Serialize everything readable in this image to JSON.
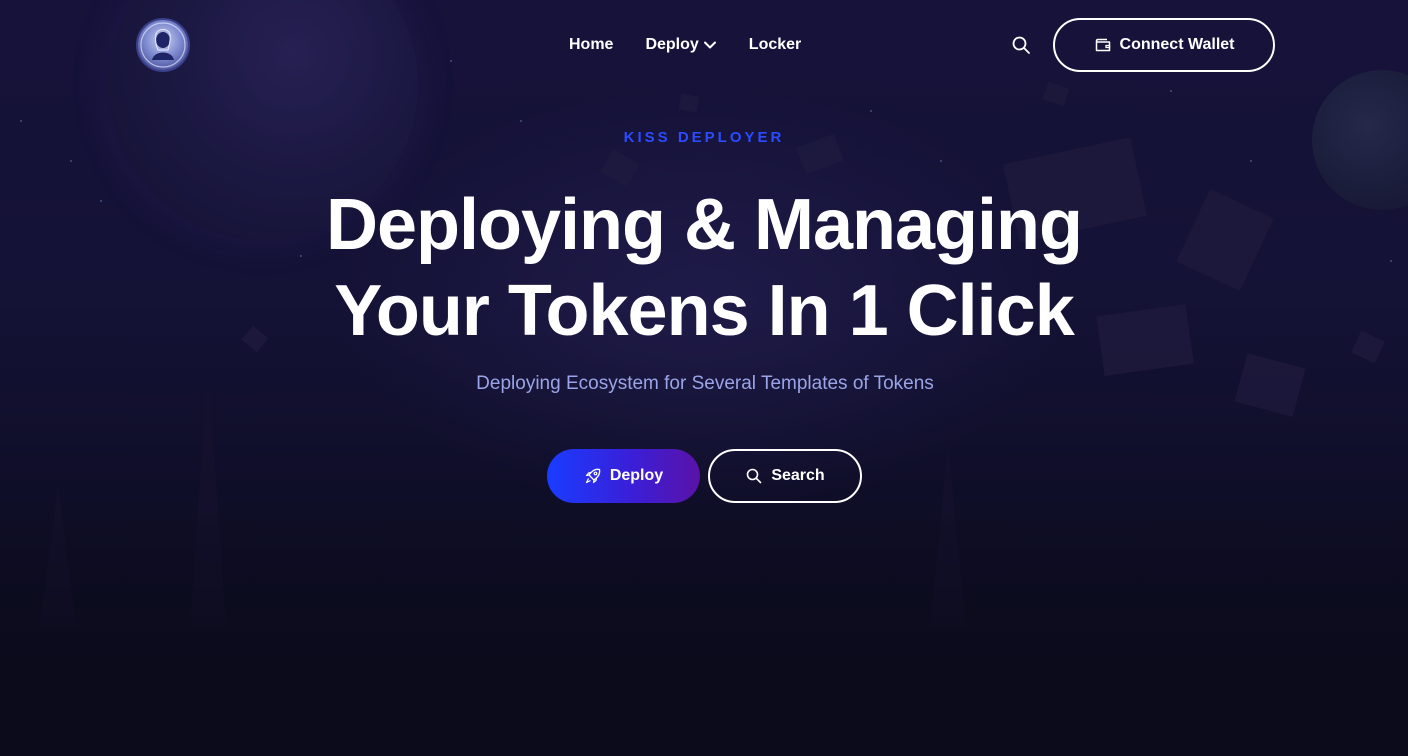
{
  "header": {
    "logo_icon": "kiss-portrait-logo-icon",
    "nav": [
      {
        "label": "Home",
        "has_dropdown": false
      },
      {
        "label": "Deploy",
        "has_dropdown": true
      },
      {
        "label": "Locker",
        "has_dropdown": false
      }
    ],
    "search_icon": "search-icon",
    "connect_wallet": {
      "label": "Connect Wallet",
      "icon": "wallet-icon"
    }
  },
  "hero": {
    "eyebrow": "KISS DEPLOYER",
    "title_line1": "Deploying & Managing",
    "title_line2": "Your Tokens In 1 Click",
    "subtitle": "Deploying Ecosystem for Several Templates of Tokens",
    "buttons": {
      "deploy": {
        "label": "Deploy",
        "icon": "rocket-icon"
      },
      "search": {
        "label": "Search",
        "icon": "search-icon"
      }
    }
  },
  "colors": {
    "background": "#0b0b1c",
    "accent_blue": "#2a4bff",
    "subtitle": "#9aa4e6",
    "deploy_gradient_start": "#1a3cff",
    "deploy_gradient_end": "#5a12a8",
    "text": "#ffffff"
  }
}
